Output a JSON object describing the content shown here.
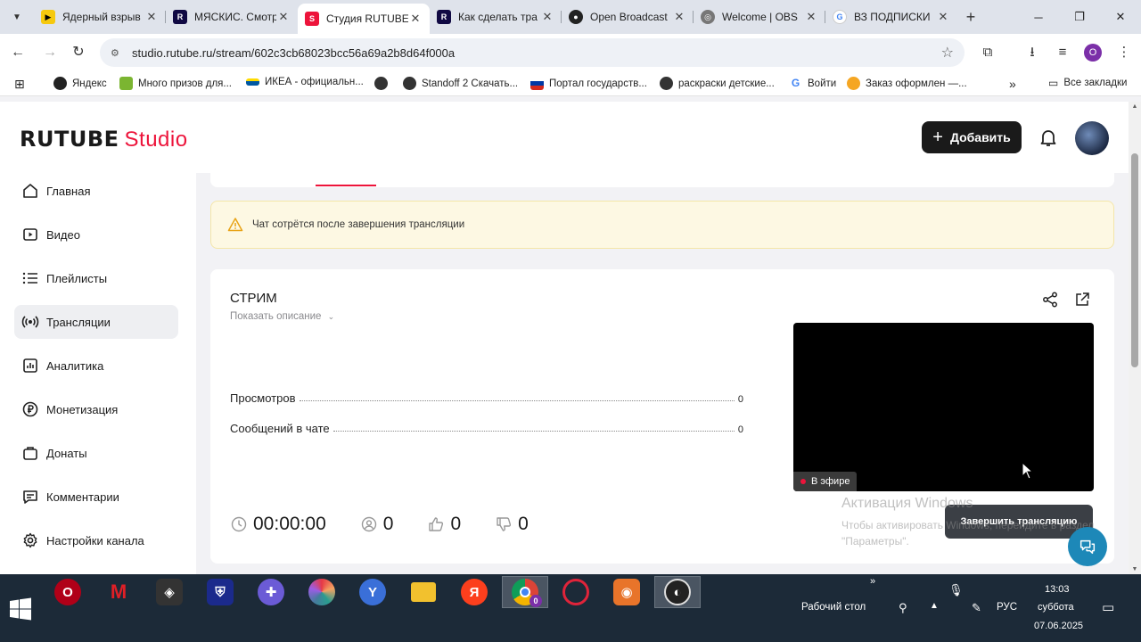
{
  "browser": {
    "tabs": [
      {
        "title": "Ядерный взрыв",
        "favicon": "youtube-icon",
        "color": "#f6c90e"
      },
      {
        "title": "МЯСКИС. Смотр",
        "favicon": "rutube-icon",
        "color": "#100943"
      },
      {
        "title": "Студия RUTUBE",
        "favicon": "rutube-studio-icon",
        "color": "#ed143b"
      },
      {
        "title": "Как сделать тра",
        "favicon": "rutube-icon",
        "color": "#100943"
      },
      {
        "title": "Open Broadcast",
        "favicon": "github-icon",
        "color": "#222222"
      },
      {
        "title": "Welcome | OBS",
        "favicon": "globe-icon",
        "color": "#555555"
      },
      {
        "title": "ВЗ ПОДПИСКИ",
        "favicon": "google-icon",
        "color": "#4285f4"
      }
    ],
    "url": "studio.rutube.ru/stream/602c3cb68023bcc56a69a2b8d64f000a",
    "profile_initial": "O",
    "bookmarks": [
      {
        "label": "Яндекс"
      },
      {
        "label": "Много призов для..."
      },
      {
        "label": "ИКЕА - официальн..."
      },
      {
        "label": ""
      },
      {
        "label": "Standoff 2 Скачать..."
      },
      {
        "label": "Портал государств..."
      },
      {
        "label": "раскраски детские..."
      },
      {
        "label": "Войти"
      },
      {
        "label": "Заказ оформлен —..."
      }
    ],
    "all_bookmarks": "Все закладки"
  },
  "header": {
    "logo_main": "RUTUBE",
    "logo_sub": "Studio",
    "add_label": "Добавить"
  },
  "sidebar": {
    "items": [
      {
        "label": "Главная",
        "icon": "home-icon"
      },
      {
        "label": "Видео",
        "icon": "video-icon"
      },
      {
        "label": "Плейлисты",
        "icon": "playlist-icon"
      },
      {
        "label": "Трансляции",
        "icon": "broadcast-icon",
        "active": true
      },
      {
        "label": "Аналитика",
        "icon": "analytics-icon"
      },
      {
        "label": "Монетизация",
        "icon": "ruble-icon"
      },
      {
        "label": "Донаты",
        "icon": "donate-icon"
      },
      {
        "label": "Комментарии",
        "icon": "comments-icon"
      },
      {
        "label": "Настройки канала",
        "icon": "gear-icon"
      }
    ]
  },
  "main": {
    "notice": "Чат сотрётся после завершения трансляции",
    "stream_title": "СТРИМ",
    "show_description": "Показать описание",
    "stats": [
      {
        "label": "Просмотров",
        "value": "0"
      },
      {
        "label": "Сообщений в чате",
        "value": "0"
      }
    ],
    "duration": "00:00:00",
    "viewers": "0",
    "likes": "0",
    "dislikes": "0",
    "live_badge": "В эфире",
    "end_button": "Завершить трансляцию"
  },
  "overlay": {
    "activation_title": "Активация Windows",
    "activation_text": "Чтобы активировать Windows, перейдите в раздел \"Параметры\"."
  },
  "taskbar": {
    "desktop_label": "Рабочий стол",
    "lang": "РУС",
    "time": "13:03",
    "day": "суббота",
    "date": "07.06.2025",
    "chrome_badge": "0"
  }
}
